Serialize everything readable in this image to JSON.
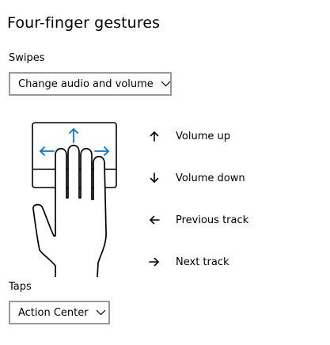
{
  "page": {
    "title": "Four-finger gestures"
  },
  "swipes": {
    "label": "Swipes",
    "selected": "Change audio and volume",
    "icon": "chevron-down-icon"
  },
  "gestures": [
    {
      "icon": "arrow-up-icon",
      "label": "Volume up"
    },
    {
      "icon": "arrow-down-icon",
      "label": "Volume down"
    },
    {
      "icon": "arrow-left-icon",
      "label": "Previous track"
    },
    {
      "icon": "arrow-right-icon",
      "label": "Next track"
    }
  ],
  "taps": {
    "label": "Taps",
    "selected": "Action Center",
    "icon": "chevron-down-icon"
  },
  "colors": {
    "accent": "#0078d7",
    "text": "#000000",
    "border": "#999999",
    "background": "#ffffff"
  }
}
